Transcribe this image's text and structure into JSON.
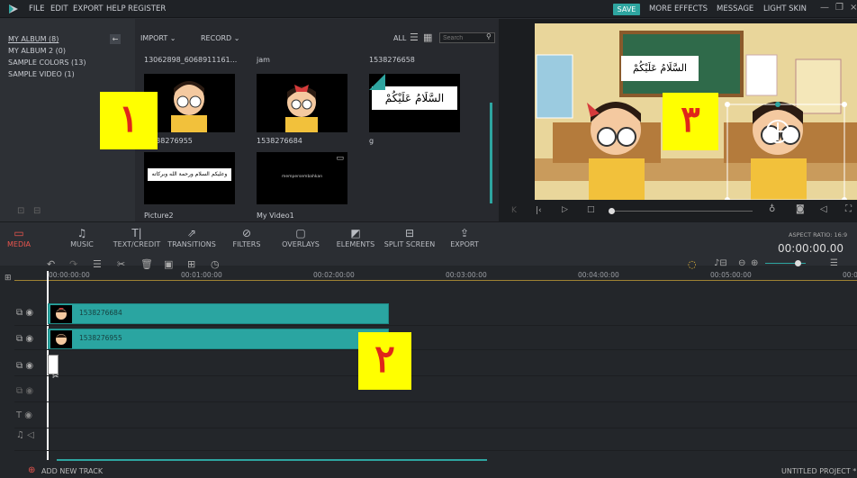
{
  "menu": {
    "items": [
      "FILE",
      "EDIT",
      "EXPORT",
      "HELP",
      "REGISTER"
    ]
  },
  "topbar": {
    "save": "SAVE",
    "more_effects": "MORE EFFECTS",
    "message": "MESSAGE",
    "light_skin": "LIGHT SKIN"
  },
  "sidebar": {
    "items": [
      "MY ALBUM (8)",
      "MY ALBUM 2 (0)",
      "SAMPLE COLORS (13)",
      "SAMPLE VIDEO (1)"
    ]
  },
  "media": {
    "import": "IMPORT",
    "record": "RECORD",
    "all": "ALL",
    "search_placeholder": "Search",
    "row1": [
      {
        "top_label": "13062898_6068911161...",
        "bottom_label": "1538276955"
      },
      {
        "top_label": "jam",
        "bottom_label": "1538276684"
      },
      {
        "top_label": "1538276658",
        "bottom_label": "g"
      }
    ],
    "row2": [
      {
        "bottom_label": "Picture2",
        "text": "وعليكم السلام ورحمة الله وبركاته"
      },
      {
        "bottom_label": "My Video1",
        "text": "mempersembahkan"
      }
    ],
    "arabic_thumb": "السَّلَامُ عَلَيْكُمْ"
  },
  "preview": {
    "bubble": "السَّلَامُ عَلَيْكُمْ",
    "aspect_ratio": "ASPECT RATIO: 16:9",
    "timecode": "00:00:00.00"
  },
  "annotations": {
    "one": "١",
    "two": "٢",
    "three": "٣"
  },
  "toolbar": {
    "items": [
      "MEDIA",
      "MUSIC",
      "TEXT/CREDIT",
      "TRANSITIONS",
      "FILTERS",
      "OVERLAYS",
      "ELEMENTS",
      "SPLIT SCREEN",
      "EXPORT"
    ]
  },
  "timeline": {
    "ruler": [
      "00:00:00:00",
      "00:01:00:00",
      "00:02:00:00",
      "00:03:00:00",
      "00:04:00:00",
      "00:05:00:00",
      "00:0"
    ],
    "clips": [
      "1538276684",
      "1538276955"
    ],
    "add_track": "ADD NEW TRACK",
    "project": "UNTITLED PROJECT *"
  },
  "colors": {
    "accent": "#2ea5a0",
    "active": "#e8554e",
    "annotation_bg": "#ffff00",
    "annotation_fg": "#e0261a"
  }
}
